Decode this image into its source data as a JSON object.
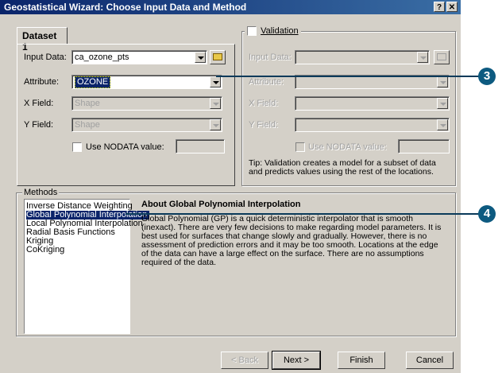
{
  "window": {
    "title": "Geostatistical Wizard: Choose Input Data and Method",
    "help_glyph": "?",
    "close_glyph": "✕"
  },
  "dataset": {
    "tab_label": "Dataset 1",
    "input_data_label": "Input Data:",
    "input_data_value": "ca_ozone_pts",
    "attribute_label": "Attribute:",
    "attribute_value": "OZONE",
    "x_field_label": "X Field:",
    "x_field_value": "Shape",
    "y_field_label": "Y Field:",
    "y_field_value": "Shape",
    "nodata_label": "Use NODATA value:",
    "nodata_value": ""
  },
  "validation": {
    "label": "Validation",
    "input_data_label": "Input Data:",
    "attribute_label": "Attribute:",
    "x_field_label": "X Field:",
    "y_field_label": "Y Field:",
    "nodata_label": "Use NODATA value:",
    "tip": "Tip:  Validation creates a model for a subset of data and predicts values using the rest of the locations."
  },
  "methods": {
    "label": "Methods",
    "items": [
      "Inverse Distance Weighting",
      "Global Polynomial Interpolation",
      "Local Polynomial Interpolation",
      "Radial Basis Functions",
      "Kriging",
      "CoKriging"
    ],
    "selected": "Global Polynomial Interpolation",
    "about_title": "About Global Polynomial Interpolation",
    "about_text": "Global Polynomial (GP) is a quick deterministic interpolator that is smooth (inexact). There are very few decisions to make regarding model parameters. It is best used for surfaces that change slowly and gradually. However, there is no assessment of prediction errors and it may be too smooth.  Locations at the edge of the data can have a large effect on the surface. There are no assumptions required of the data."
  },
  "buttons": {
    "back": "< Back",
    "next": "Next >",
    "finish": "Finish",
    "cancel": "Cancel"
  },
  "callouts": {
    "one": "3",
    "two": "4"
  },
  "icons": {
    "folder": "open-folder-icon",
    "dropdown": "chevron-down-icon"
  }
}
